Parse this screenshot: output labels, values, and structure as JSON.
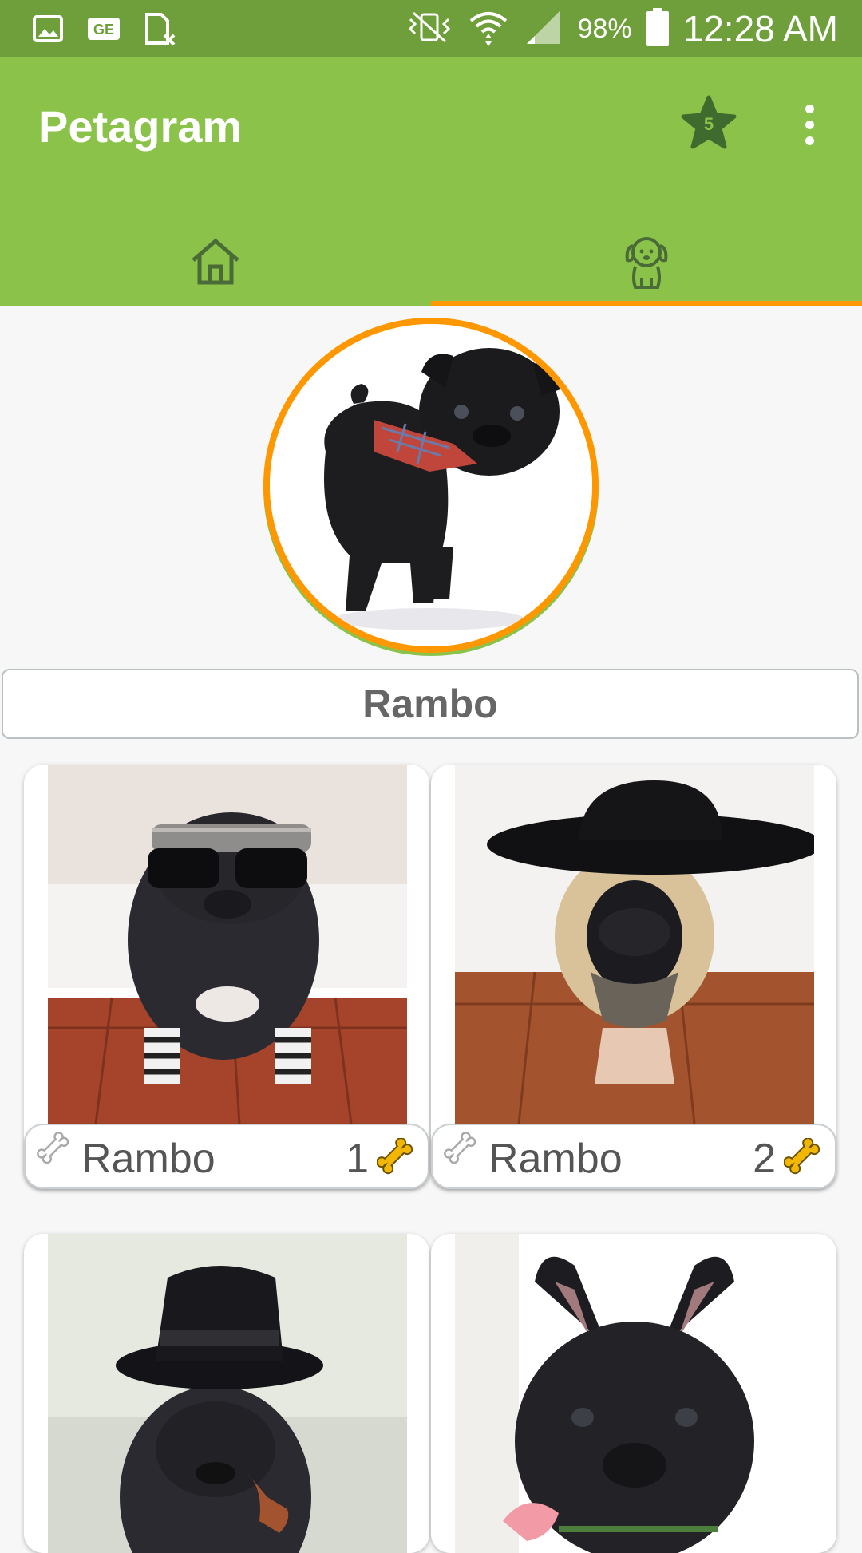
{
  "status_bar": {
    "battery": "98%",
    "time": "12:28 AM"
  },
  "app_bar": {
    "title": "Petagram",
    "favorites_count": "5"
  },
  "tabs": [
    {
      "name": "home",
      "icon": "home-icon",
      "selected": false
    },
    {
      "name": "profile",
      "icon": "dog-icon",
      "selected": true
    }
  ],
  "profile": {
    "name": "Rambo"
  },
  "pets": [
    {
      "name": "Rambo",
      "likes": "1"
    },
    {
      "name": "Rambo",
      "likes": "2"
    },
    {
      "name": "",
      "likes": ""
    },
    {
      "name": "",
      "likes": ""
    }
  ],
  "colors": {
    "primary": "#8bc34a",
    "primary_dark": "#6e9f3a",
    "accent": "#ff9800",
    "bone": "#f2b705"
  }
}
